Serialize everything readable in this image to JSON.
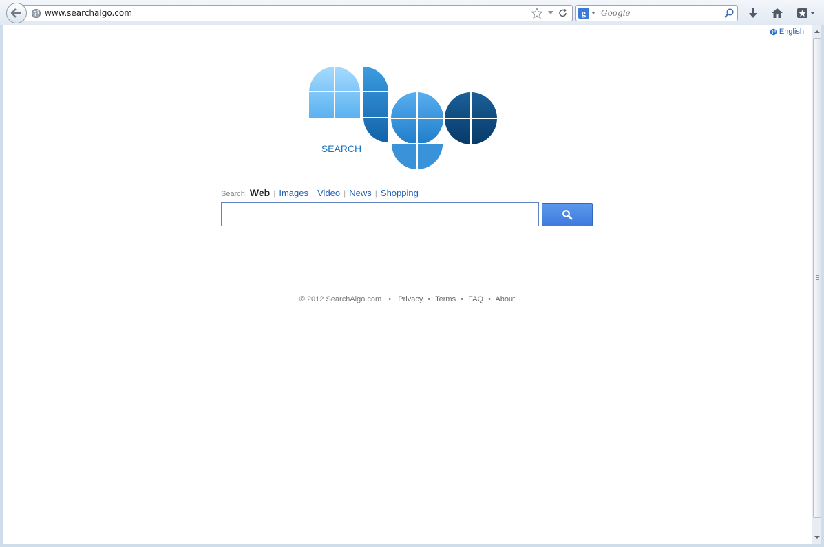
{
  "browser": {
    "url": "www.searchalgo.com",
    "search_engine": "Google",
    "search_placeholder": "Google",
    "icons": {
      "back": "back-arrow-icon",
      "bookmark": "star-icon",
      "dropdown": "chevron-down-icon",
      "reload": "reload-icon",
      "search": "magnifier-icon",
      "downloads": "download-arrow-icon",
      "home": "home-icon",
      "bookmarks": "bookmarks-star-icon"
    }
  },
  "page": {
    "language": "English",
    "logo": {
      "text": "SEARCH",
      "colors": [
        "#7cc4f6",
        "#2c8fd6",
        "#1a6cae",
        "#0b4878"
      ]
    },
    "search": {
      "label": "Search:",
      "tabs": [
        {
          "label": "Web",
          "active": true
        },
        {
          "label": "Images",
          "active": false
        },
        {
          "label": "Video",
          "active": false
        },
        {
          "label": "News",
          "active": false
        },
        {
          "label": "Shopping",
          "active": false
        }
      ],
      "input_value": "",
      "button_icon": "magnifier-icon",
      "button_color": "#4a86e4"
    },
    "footer": {
      "copyright": "© 2012 SearchAlgo.com",
      "links": [
        "Privacy",
        "Terms",
        "FAQ",
        "About"
      ]
    }
  }
}
